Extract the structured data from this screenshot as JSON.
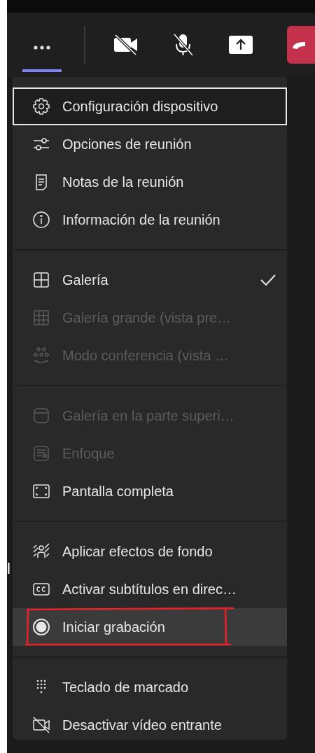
{
  "toolbar": {
    "items": [
      {
        "kind": "more",
        "selected": true
      },
      {
        "kind": "camera",
        "selected": false
      },
      {
        "kind": "mic",
        "selected": false
      },
      {
        "kind": "share",
        "selected": false
      },
      {
        "kind": "hangup",
        "selected": false
      }
    ]
  },
  "edge_text": "l",
  "menu": {
    "sections": [
      {
        "items": [
          {
            "label": "Configuración dispositivo",
            "focused": true,
            "highlighted": false,
            "disabled": false,
            "checked": false,
            "annotated": false
          },
          {
            "label": "Opciones de reunión",
            "focused": false,
            "highlighted": false,
            "disabled": false,
            "checked": false,
            "annotated": false
          },
          {
            "label": "Notas de la reunión",
            "focused": false,
            "highlighted": false,
            "disabled": false,
            "checked": false,
            "annotated": false
          },
          {
            "label": "Información de la reunión",
            "focused": false,
            "highlighted": false,
            "disabled": false,
            "checked": false,
            "annotated": false
          }
        ]
      },
      {
        "items": [
          {
            "label": "Galería",
            "focused": false,
            "highlighted": false,
            "disabled": false,
            "checked": true,
            "annotated": false
          },
          {
            "label": "Galería grande (vista pre…",
            "focused": false,
            "highlighted": false,
            "disabled": true,
            "checked": false,
            "annotated": false
          },
          {
            "label": "Modo conferencia (vista …",
            "focused": false,
            "highlighted": false,
            "disabled": true,
            "checked": false,
            "annotated": false
          }
        ]
      },
      {
        "items": [
          {
            "label": "Galería en la parte superi…",
            "focused": false,
            "highlighted": false,
            "disabled": true,
            "checked": false,
            "annotated": false
          },
          {
            "label": "Enfoque",
            "focused": false,
            "highlighted": false,
            "disabled": true,
            "checked": false,
            "annotated": false
          },
          {
            "label": "Pantalla completa",
            "focused": false,
            "highlighted": false,
            "disabled": false,
            "checked": false,
            "annotated": false
          }
        ]
      },
      {
        "items": [
          {
            "label": "Aplicar efectos de fondo",
            "focused": false,
            "highlighted": false,
            "disabled": false,
            "checked": false,
            "annotated": false
          },
          {
            "label": "Activar subtítulos en direc…",
            "focused": false,
            "highlighted": false,
            "disabled": false,
            "checked": false,
            "annotated": false
          },
          {
            "label": "Iniciar grabación",
            "focused": false,
            "highlighted": true,
            "disabled": false,
            "checked": false,
            "annotated": true
          }
        ]
      },
      {
        "items": [
          {
            "label": "Teclado de marcado",
            "focused": false,
            "highlighted": false,
            "disabled": false,
            "checked": false,
            "annotated": false
          },
          {
            "label": "Desactivar vídeo entrante",
            "focused": false,
            "highlighted": false,
            "disabled": false,
            "checked": false,
            "annotated": false
          }
        ]
      }
    ]
  }
}
